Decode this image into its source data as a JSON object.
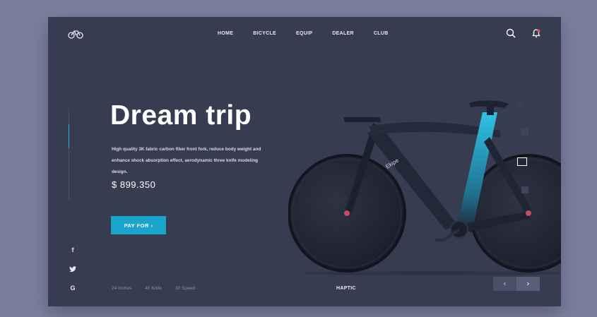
{
  "nav": {
    "items": [
      "HOME",
      "BICYCLE",
      "EQUIP",
      "DEALER",
      "CLUB"
    ]
  },
  "icons": {
    "logo": "bicycle-logo-icon",
    "search": "search-icon",
    "notification": "bell-icon",
    "social": [
      "facebook-icon",
      "twitter-icon",
      "google-icon"
    ]
  },
  "social": {
    "facebook": "f",
    "google": "G"
  },
  "hero": {
    "title": "Dream trip",
    "description": "High quality 3K fabric carbon fiber front fork, reduce body weight and enhance shock absorption effect, aerodynamic three knife modeling design.",
    "price": "$ 899.350",
    "cta": "PAY FOR ›"
  },
  "specs": [
    "24 Inches",
    "40 Knife",
    "30 Speed"
  ],
  "product": {
    "model": "HAPTIC",
    "frame_text": "Ekipe"
  },
  "slider": {
    "prev": "‹",
    "next": "›"
  },
  "colors": {
    "background": "#7b7f9c",
    "card": "#373c51",
    "accent": "#1aa6cc"
  }
}
